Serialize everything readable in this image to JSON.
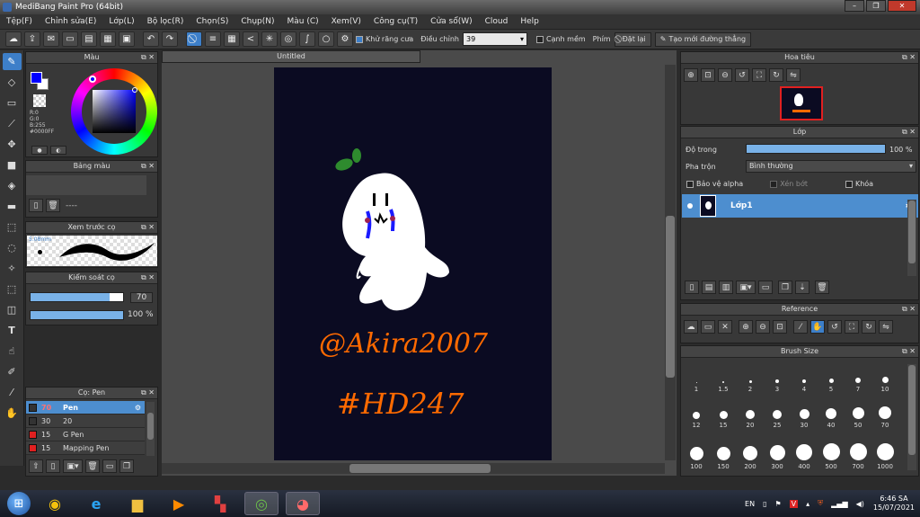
{
  "window": {
    "title": "MediBang Paint Pro (64bit)"
  },
  "menu": [
    "Tệp(F)",
    "Chỉnh sửa(E)",
    "Lớp(L)",
    "Bộ lọc(R)",
    "Chọn(S)",
    "Chụp(N)",
    "Màu (C)",
    "Xem(V)",
    "Công cụ(T)",
    "Cửa sổ(W)",
    "Cloud",
    "Help"
  ],
  "toolbar": {
    "antialias_label": "Khử răng cưa",
    "correction_label": "Điều chỉnh",
    "correction_value": "39",
    "snap_label": "Cạnh mềm",
    "key_label": "Phím",
    "reset_label": "Đặt lại",
    "new_ruler_label": "Tạo mới đường thẳng"
  },
  "color_panel": {
    "title": "Màu",
    "r": "R:0",
    "g": "G:0",
    "b": "B:255",
    "hex": "#0000FF",
    "primary": "#0000FF",
    "secondary": "#FFFFFF"
  },
  "palette_panel": {
    "title": "Bảng màu",
    "placeholder": "----"
  },
  "brush_preview": {
    "title": "Xem trước cọ",
    "size": "5.08mm"
  },
  "brush_control": {
    "title": "Kiểm soát cọ",
    "size_value": "70",
    "size_pct": 0.85,
    "opacity_value": "100 %",
    "opacity_pct": 1.0
  },
  "brush_list": {
    "title": "Cọ: Pen",
    "items": [
      {
        "size": "70",
        "name": "Pen",
        "color": "#333333",
        "selected": true
      },
      {
        "size": "30",
        "name": "20",
        "color": "#333333",
        "selected": false
      },
      {
        "size": "15",
        "name": "G Pen",
        "color": "#e02020",
        "selected": false
      },
      {
        "size": "15",
        "name": "Mapping Pen",
        "color": "#e02020",
        "selected": false
      }
    ]
  },
  "document": {
    "tab_title": "Untitled",
    "line1": "@Akira2007",
    "line2": "#HD247"
  },
  "navigator": {
    "title": "Hoa tiêu"
  },
  "layer_panel": {
    "title": "Lớp",
    "opacity_label": "Độ trong",
    "opacity_value": "100 %",
    "blend_label": "Pha trộn",
    "blend_value": "Bình thường",
    "protect_alpha": "Bảo vệ alpha",
    "clipping": "Xén bớt",
    "lock": "Khóa",
    "layer_name": "Lớp1"
  },
  "reference_panel": {
    "title": "Reference"
  },
  "brush_size_panel": {
    "title": "Brush Size",
    "rows": [
      [
        "1",
        "1.5",
        "2",
        "3",
        "4",
        "5",
        "7",
        "10"
      ],
      [
        "12",
        "15",
        "20",
        "25",
        "30",
        "40",
        "50",
        "70"
      ],
      [
        "100",
        "150",
        "200",
        "300",
        "400",
        "500",
        "700",
        "1000"
      ]
    ]
  },
  "taskbar": {
    "lang": "EN",
    "time": "6:46 SA",
    "date": "15/07/2021"
  }
}
